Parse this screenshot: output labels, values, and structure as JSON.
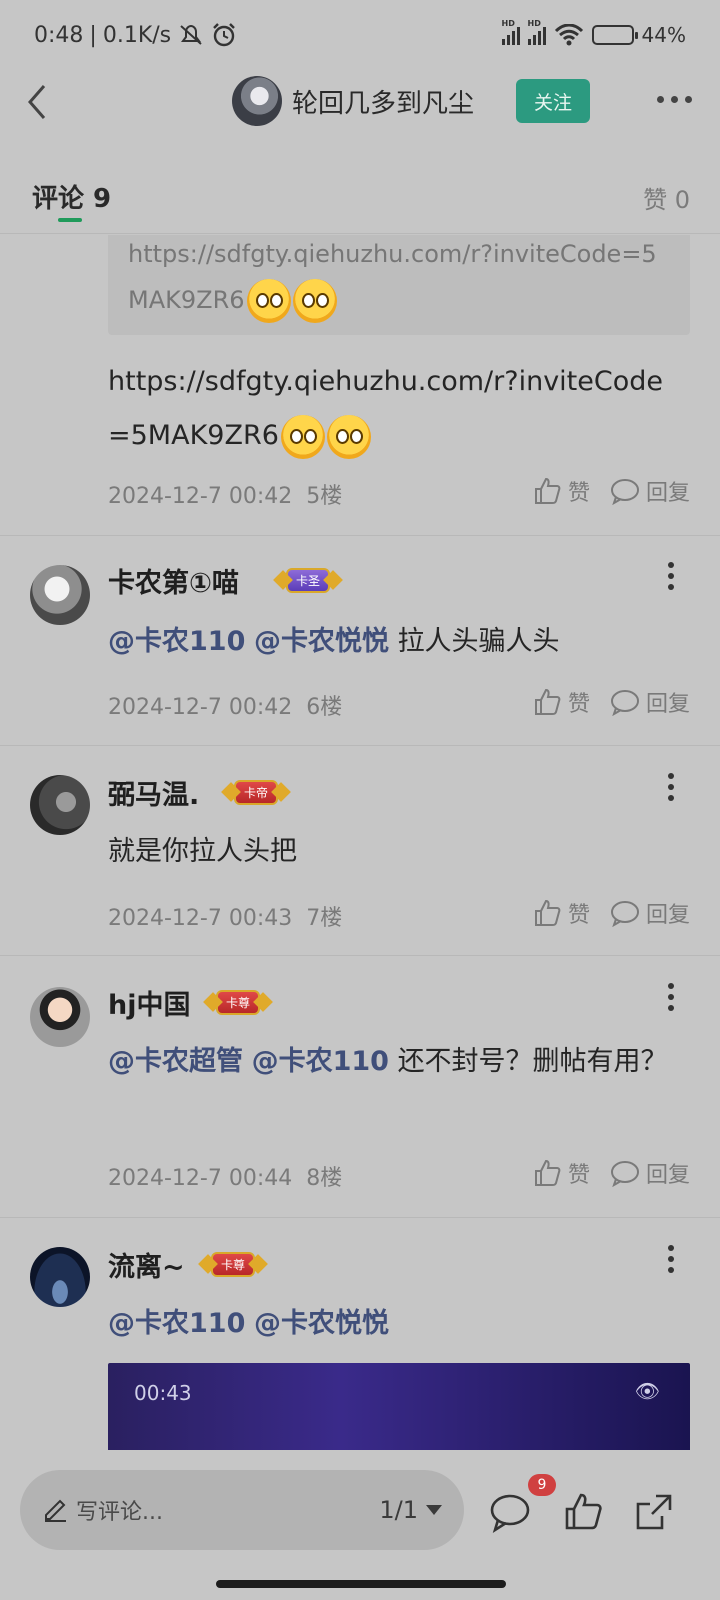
{
  "status_bar": {
    "time": "0:48",
    "separator": "|",
    "net_speed": "0.1K/s",
    "battery_percent": "44%",
    "battery_level": 0.44
  },
  "nav": {
    "title": "轮回几多到凡尘",
    "follow_label": "关注"
  },
  "tabs": {
    "comments_label": "评论 9",
    "likes_label": "赞 0"
  },
  "comments": [
    {
      "quote": "https://sdfgty.qiehuzhu.com/r?inviteCode=5MAK9ZR6",
      "text": "https://sdfgty.qiehuzhu.com/r?inviteCode=5MAK9ZR6",
      "date": "2024-12-7 00:42",
      "floor": "5楼"
    },
    {
      "user": "卡农第①喵",
      "badge": "卡圣",
      "mentions": [
        "@卡农110",
        "@卡农悦悦"
      ],
      "text": "拉人头骗人头",
      "date": "2024-12-7 00:42",
      "floor": "6楼"
    },
    {
      "user": "弼马温.",
      "badge": "卡帝",
      "text": "就是你拉人头把",
      "date": "2024-12-7 00:43",
      "floor": "7楼"
    },
    {
      "user": "hj中国",
      "badge": "卡尊",
      "mentions": [
        "@卡农超管",
        "@卡农110"
      ],
      "text": "还不封号？删帖有用？",
      "date": "2024-12-7 00:44",
      "floor": "8楼"
    },
    {
      "user": "流离~",
      "badge": "卡尊",
      "mentions": [
        "@卡农110",
        "@卡农悦悦"
      ],
      "video_time": "00:43"
    }
  ],
  "actions": {
    "like_label": "赞",
    "reply_label": "回复"
  },
  "bottom": {
    "compose_placeholder": "写评论...",
    "pager": "1/1",
    "comment_count": "9"
  },
  "icons": [
    "back-icon",
    "more-icon",
    "like-icon",
    "reply-icon",
    "pencil-icon",
    "comment-icon",
    "thumb-icon",
    "share-icon"
  ]
}
